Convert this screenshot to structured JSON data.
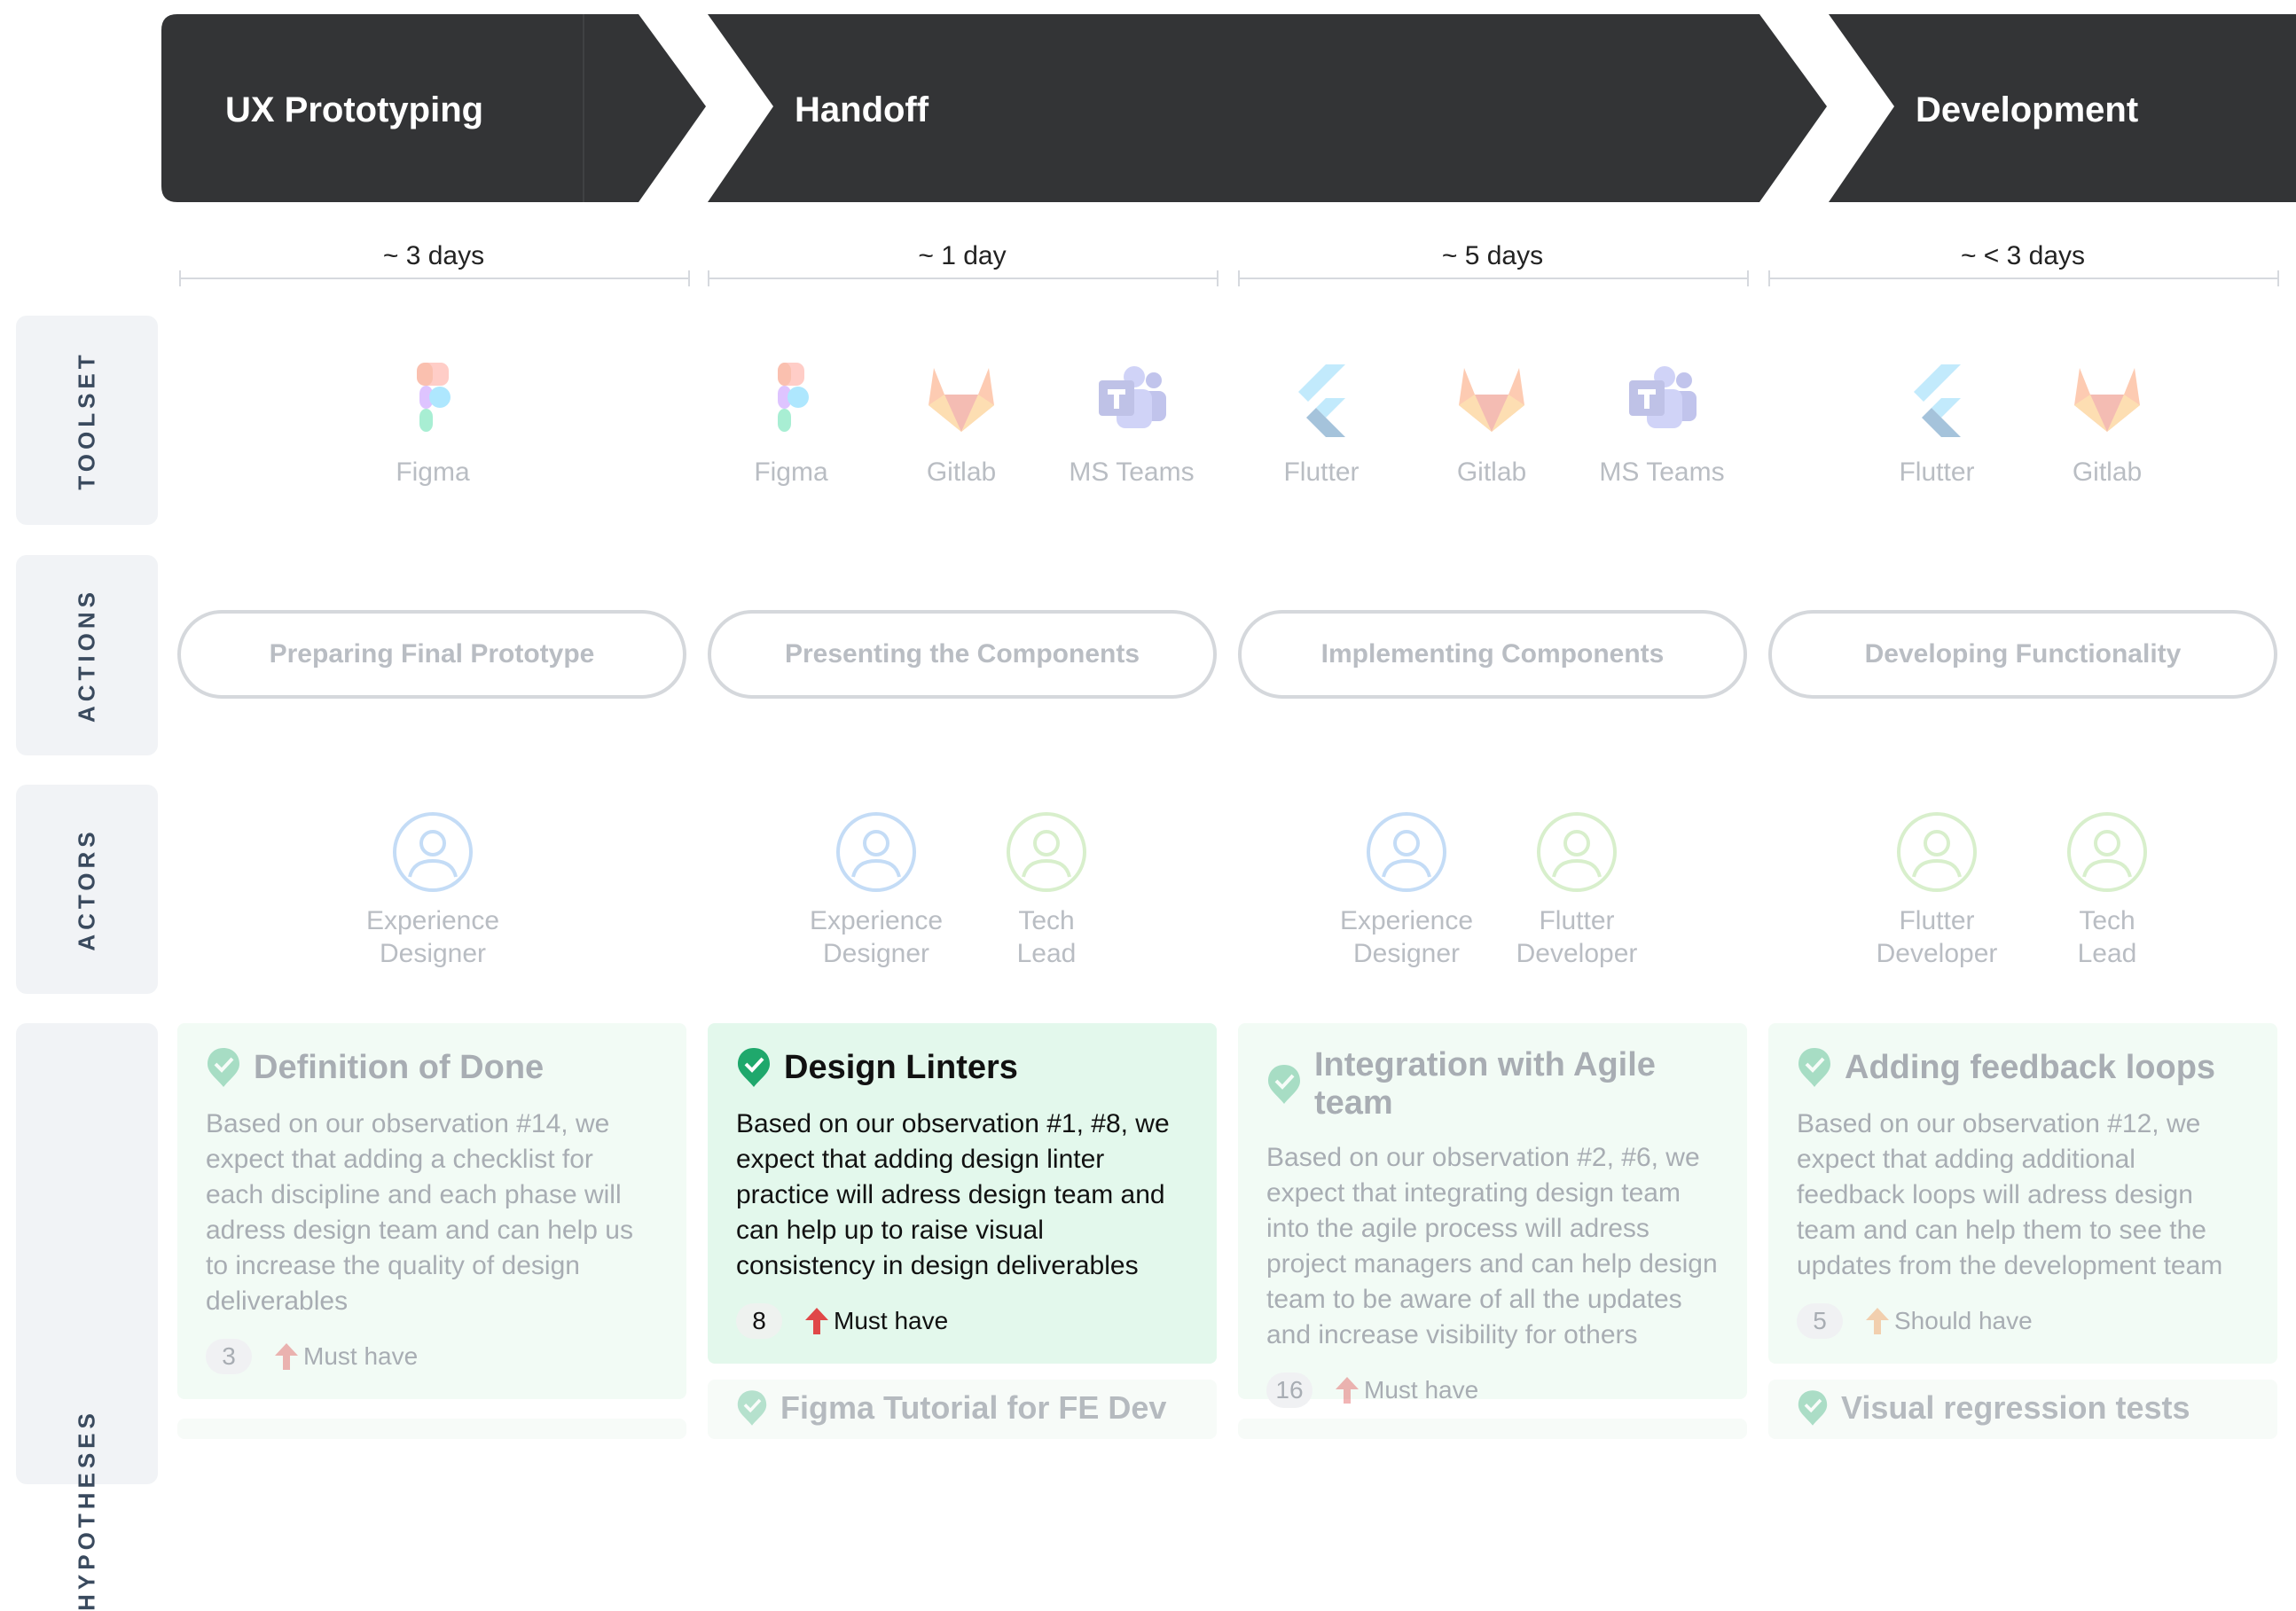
{
  "phases": [
    {
      "label": "UX Prototyping"
    },
    {
      "label": "Handoff"
    },
    {
      "label": "Development"
    }
  ],
  "durations": [
    "~ 3 days",
    "~ 1 day",
    "~ 5 days",
    "~ < 3 days"
  ],
  "rows": {
    "toolset": "TOOLSET",
    "actions": "ACTIONS",
    "actors": "ACTORS",
    "hypotheses": "HYPOTHESES"
  },
  "tools": [
    {
      "name": "Figma",
      "icon": "figma-icon"
    },
    {
      "name": "Figma",
      "icon": "figma-icon"
    },
    {
      "name": "Gitlab",
      "icon": "gitlab-icon"
    },
    {
      "name": "MS Teams",
      "icon": "ms-teams-icon"
    },
    {
      "name": "Flutter",
      "icon": "flutter-icon"
    },
    {
      "name": "Gitlab",
      "icon": "gitlab-icon"
    },
    {
      "name": "MS Teams",
      "icon": "ms-teams-icon"
    },
    {
      "name": "Flutter",
      "icon": "flutter-icon"
    },
    {
      "name": "Gitlab",
      "icon": "gitlab-icon"
    }
  ],
  "actions": [
    "Preparing Final Prototype",
    "Presenting the Components",
    "Implementing Components",
    "Developing Functionality"
  ],
  "actors": [
    {
      "line1": "Experience",
      "line2": "Designer",
      "color": "#c4dcf6"
    },
    {
      "line1": "Experience",
      "line2": "Designer",
      "color": "#c4dcf6"
    },
    {
      "line1": "Tech",
      "line2": "Lead",
      "color": "#d8efcc"
    },
    {
      "line1": "Experience",
      "line2": "Designer",
      "color": "#c4dcf6"
    },
    {
      "line1": "Flutter",
      "line2": "Developer",
      "color": "#d8efcc"
    },
    {
      "line1": "Flutter",
      "line2": "Developer",
      "color": "#d8efcc"
    },
    {
      "line1": "Tech",
      "line2": "Lead",
      "color": "#d8efcc"
    }
  ],
  "hypotheses": [
    {
      "title": "Definition of Done",
      "body": "Based on our observation #14, we expect that adding a checklist for each discipline and each phase will adress design team and can help us to increase the quality of design deliverables",
      "count": "3",
      "priority": "Must have"
    },
    {
      "title": "Design Linters",
      "body": "Based on our observation #1, #8, we expect that adding design linter practice will adress design team and can help up to raise visual consistency in design deliverables",
      "count": "8",
      "priority": "Must have"
    },
    {
      "title": "Integration with Agile team",
      "body": "Based on our observation #2, #6, we expect that integrating design team into the agile process will adress project managers and can help design team to be aware of all the updates and increase visibility for others",
      "count": "16",
      "priority": "Must have"
    },
    {
      "title": "Adding feedback loops",
      "body": "Based on our observation #12, we expect that adding additional feedback loops will adress design team and can help them to see the updates from the development team",
      "count": "5",
      "priority": "Should have"
    }
  ],
  "hypotheses_next": [
    "Figma Tutorial for FE Dev",
    "Visual regression tests"
  ],
  "colors": {
    "phase_bg": "#333436",
    "must_have": "#e04848",
    "should_have": "#f2a56a",
    "check_badge": "#1fa86c"
  }
}
